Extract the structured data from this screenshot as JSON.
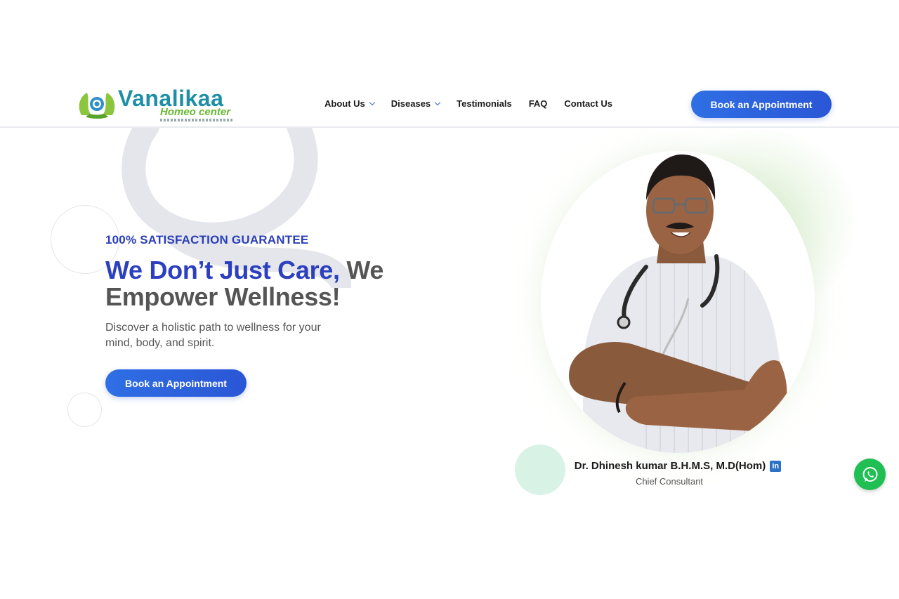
{
  "brand": {
    "name": "Vanalikaa",
    "subtitle": "Homeo center",
    "colors": {
      "teal": "#1e8fa6",
      "green": "#67b832"
    }
  },
  "nav": {
    "items": [
      {
        "label": "About Us",
        "has_dropdown": true
      },
      {
        "label": "Diseases",
        "has_dropdown": true
      },
      {
        "label": "Testimonials",
        "has_dropdown": false
      },
      {
        "label": "FAQ",
        "has_dropdown": false
      },
      {
        "label": "Contact Us",
        "has_dropdown": false
      }
    ],
    "cta_label": "Book an Appointment"
  },
  "hero": {
    "eyebrow": "100% SATISFACTION GUARANTEE",
    "headline_highlight": "We Don’t Just Care,",
    "headline_rest_1": " We",
    "headline_rest_2": "Empower Wellness!",
    "description": "Discover a holistic path to wellness for your mind, body, and spirit.",
    "cta_label": "Book an Appointment"
  },
  "doctor": {
    "name": "Dr. Dhinesh kumar B.H.M.S, M.D(Hom)",
    "role": "Chief Consultant",
    "social_icon": "linkedin-icon"
  },
  "floating": {
    "icon": "whatsapp-icon"
  },
  "theme": {
    "primary": "#2a56d6",
    "heading_blue": "#2b3fbf",
    "heading_gray": "#555555",
    "whatsapp": "#1fbf54"
  }
}
